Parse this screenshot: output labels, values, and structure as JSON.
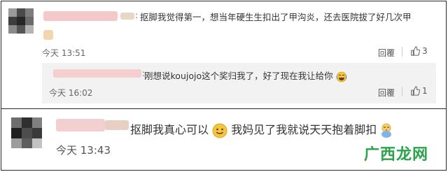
{
  "comments": [
    {
      "text": "抠脚我觉得第一，想当年硬生生扣出了甲沟炎，还去医院拔了好几次甲",
      "time": "今天 13:51",
      "reply_label": "回覆",
      "like_count": "3",
      "reply": {
        "text_before": "刚想说koujojo这个奖归我了，好了现在我让给你",
        "time": "今天 16:02",
        "reply_label": "回覆",
        "like_count": "1"
      }
    },
    {
      "text_before": "抠脚我真心可以",
      "text_after": "我妈见了我就说天天抱着脚扣",
      "time": "今天 13:43"
    }
  ],
  "watermark": {
    "text": "广西龙网"
  },
  "colors": {
    "name_link": "#4b6a9b",
    "watermark": "#2aa34a",
    "reply_bg": "#f2f2f2"
  },
  "icons": [
    "thumb-up-icon",
    "smile-emoji-icon",
    "laugh-cry-emoji-icon",
    "baby-emoji-icon"
  ]
}
